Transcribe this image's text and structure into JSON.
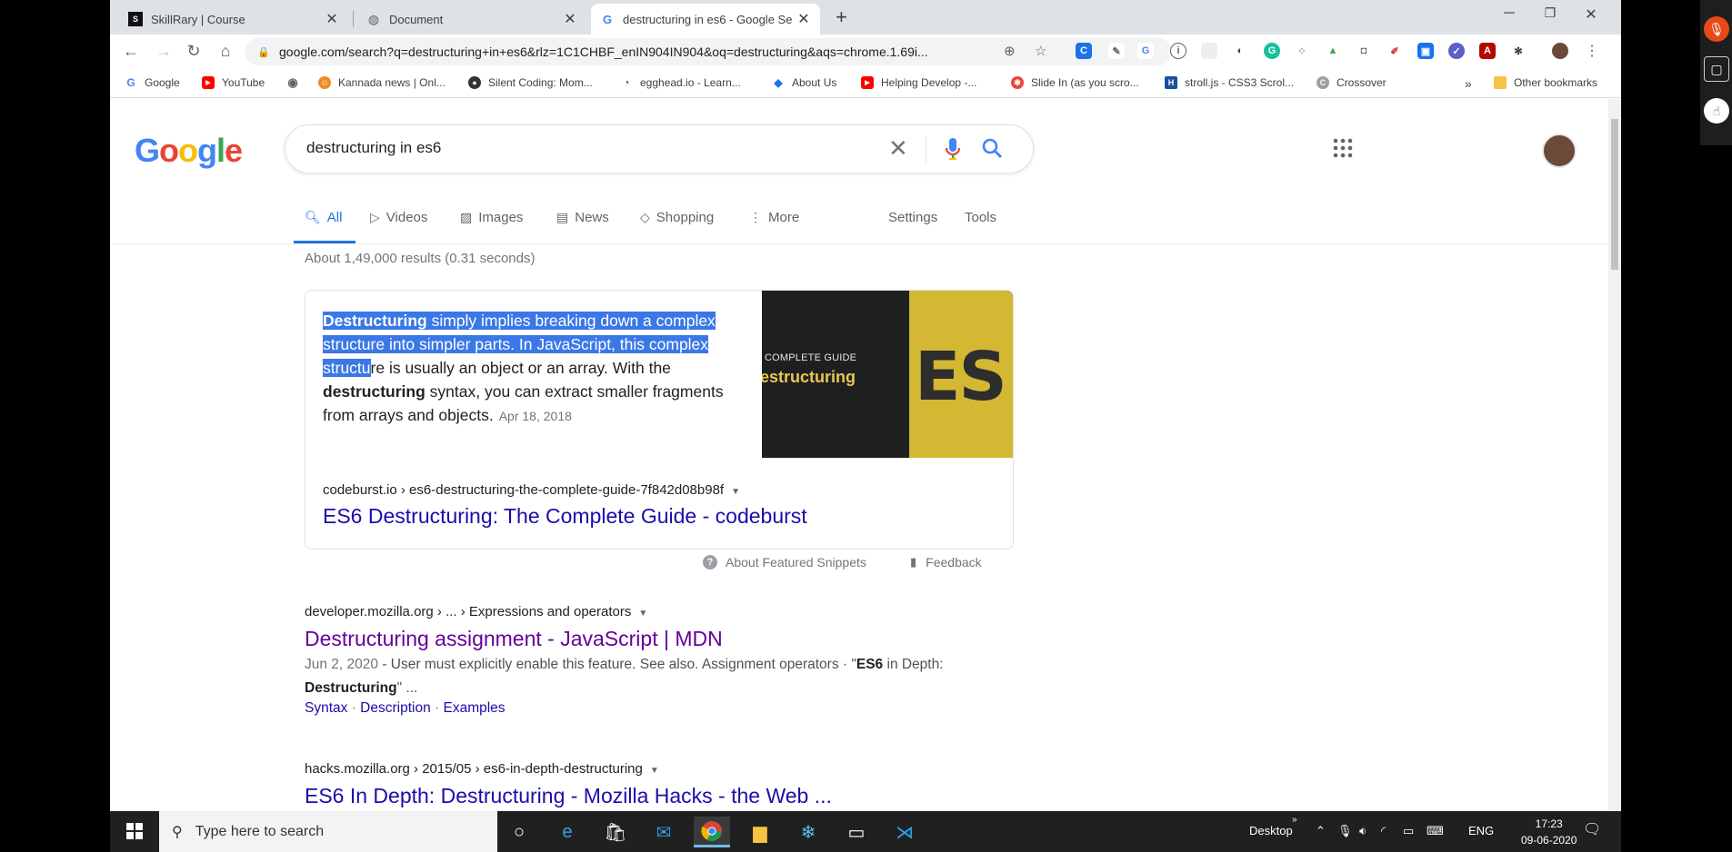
{
  "tabs": [
    {
      "title": "SkillRary | Course",
      "icon": "skillrary-icon"
    },
    {
      "title": "Document",
      "icon": "globe-icon"
    },
    {
      "title": "destructuring in es6 - Google Se",
      "icon": "google-g-icon"
    }
  ],
  "toolbar": {
    "url": "google.com/search?q=destructuring+in+es6&rlz=1C1CHBF_enIN904IN904&oq=destructuring&aqs=chrome.1.69i..."
  },
  "bookmarks": [
    {
      "label": "Google",
      "color": "#4285f4",
      "glyph": "G"
    },
    {
      "label": "YouTube",
      "color": "#ff0000",
      "glyph": "▶"
    },
    {
      "label": "",
      "color": "#5f6368",
      "glyph": "◉"
    },
    {
      "label": "Kannada news | Onl...",
      "color": "#f08a24",
      "glyph": "☺"
    },
    {
      "label": "Silent Coding: Mom...",
      "color": "#333333",
      "glyph": "●"
    },
    {
      "label": "egghead.io - Learn...",
      "color": "#777777",
      "glyph": "◔"
    },
    {
      "label": "About Us",
      "color": "#1a73e8",
      "glyph": "◆"
    },
    {
      "label": "Helping Develop -...",
      "color": "#ff0000",
      "glyph": "▶"
    },
    {
      "label": "Slide In (as you scro...",
      "color": "#e8453c",
      "glyph": "✱"
    },
    {
      "label": "stroll.js - CSS3 Scrol...",
      "color": "#1a4fa0",
      "glyph": "H"
    },
    {
      "label": "Crossover",
      "color": "#9e9e9e",
      "glyph": "C"
    }
  ],
  "other_bookmarks": "Other bookmarks",
  "search": {
    "query": "destructuring in es6"
  },
  "google_tabs": {
    "all": "All",
    "videos": "Videos",
    "images": "Images",
    "news": "News",
    "shopping": "Shopping",
    "more": "More",
    "settings": "Settings",
    "tools": "Tools"
  },
  "stats": "About 1,49,000 results (0.31 seconds)",
  "featured": {
    "s1b": "Destructuring",
    "s1": " simply implies breaking down a complex structure into simpler parts. In JavaScript, this complex structu",
    "s2": "re is usually an object or an array. With the ",
    "s3b": "destructuring",
    "s4": " syntax, you can extract smaller fragments from arrays and objects.",
    "date": "Apr 18, 2018",
    "thumb_guide": "COMPLETE GUIDE",
    "thumb_title": "estructuring",
    "thumb_es": "ES",
    "cite": "codeburst.io › es6-destructuring-the-complete-guide-7f842d08b98f",
    "title": "ES6 Destructuring: The Complete Guide - codeburst",
    "about": "About Featured Snippets",
    "feedback": "Feedback"
  },
  "results": [
    {
      "cite": "developer.mozilla.org › ... › Expressions and operators",
      "title": "Destructuring assignment - JavaScript | MDN",
      "date": "Jun 2, 2020",
      "desc1": " - User must explicitly enable this feature. See also. Assignment operators · \"",
      "desc_b1": "ES6",
      "desc2": " in Depth: ",
      "desc_b2": "Destructuring",
      "desc3": "\" ...",
      "links": [
        "Syntax",
        "Description",
        "Examples"
      ]
    },
    {
      "cite": "hacks.mozilla.org › 2015/05 › es6-in-depth-destructuring",
      "title": "ES6 In Depth: Destructuring - Mozilla Hacks - the Web ..."
    }
  ],
  "taskbar": {
    "search_placeholder": "Type here to search",
    "desktop": "Desktop",
    "lang": "ENG",
    "time": "17:23",
    "date": "09-06-2020",
    "notif": "1"
  },
  "colors": {
    "google_blue": "#4285f4",
    "google_red": "#ea4335",
    "google_yellow": "#fbbc05",
    "google_green": "#34a853",
    "link_blue": "#1a0dab",
    "visited": "#660099",
    "selection": "#3b78e7"
  }
}
